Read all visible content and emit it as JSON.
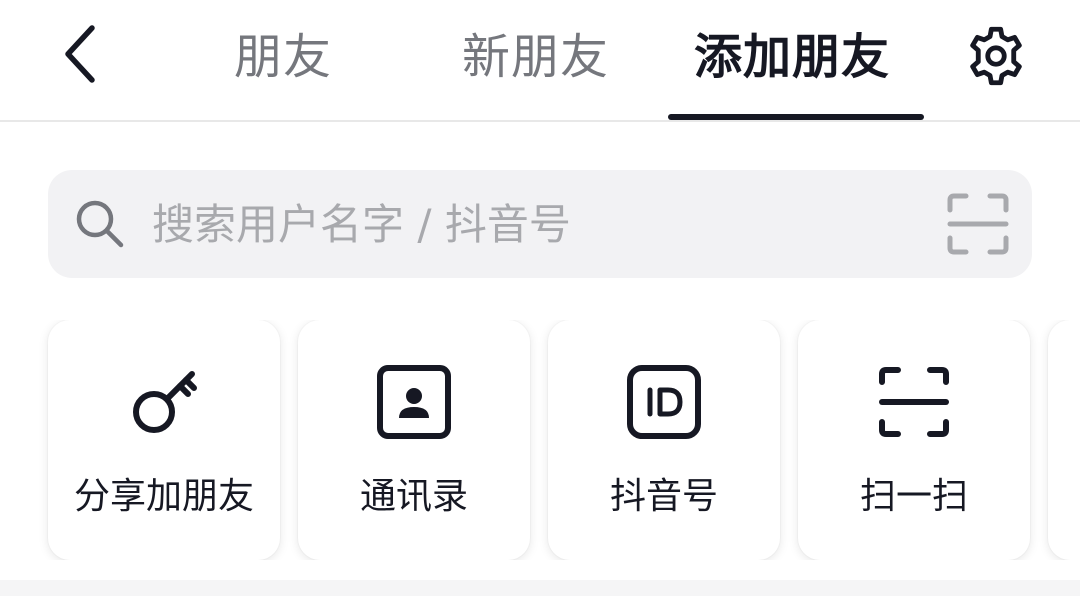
{
  "header": {
    "back_icon": "chevron-left-icon",
    "tabs": [
      {
        "label": "朋友",
        "active": false
      },
      {
        "label": "新朋友",
        "active": false
      },
      {
        "label": "添加朋友",
        "active": true
      }
    ],
    "settings_icon": "gear-icon"
  },
  "search": {
    "placeholder": "搜索用户名字 / 抖音号",
    "value": "",
    "icon": "search-icon",
    "scan_icon": "scan-icon"
  },
  "quick_actions": [
    {
      "label": "分享加朋友",
      "icon": "key-icon"
    },
    {
      "label": "通讯录",
      "icon": "contacts-icon"
    },
    {
      "label": "抖音号",
      "icon": "id-icon"
    },
    {
      "label": "扫一扫",
      "icon": "scan-icon"
    }
  ],
  "colors": {
    "text_primary": "#161823",
    "text_secondary": "#75777d",
    "placeholder": "#a8a9ad",
    "search_bg": "#f2f2f4",
    "page_bg": "#ffffff"
  }
}
